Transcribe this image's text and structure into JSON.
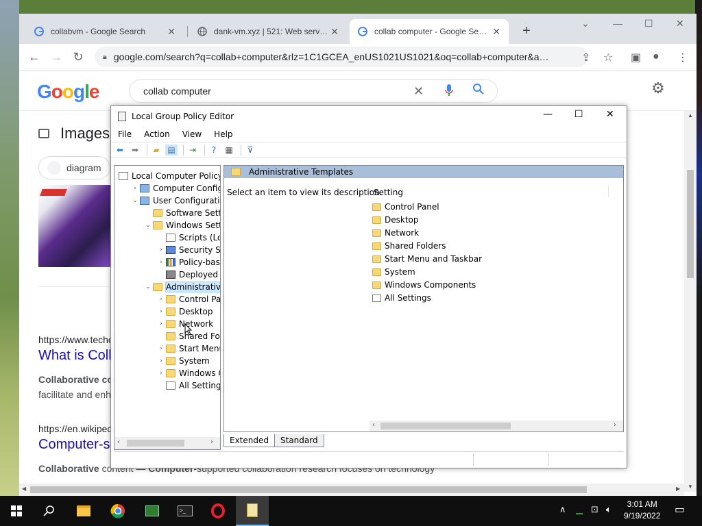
{
  "browser": {
    "tabs": [
      {
        "title": "collabvm - Google Search"
      },
      {
        "title": "dank-vm.xyz | 521: Web server is down"
      },
      {
        "title": "collab computer - Google Search"
      }
    ],
    "url": "google.com/search?q=collab+computer&rlz=1C1GCEA_enUS1021US1021&oq=collab+computer&aqs=ch..."
  },
  "google": {
    "logo": "Google",
    "query": "collab computer",
    "images_heading": "Images",
    "chip": "diagram",
    "results": [
      {
        "url": "https://www.techo",
        "title": "What is Coll",
        "snippet_bold": "Collaborative co",
        "snippet2": "facilitate and enh"
      },
      {
        "url": "https://en.wikipec",
        "title": "Computer-s",
        "snippet_bold1": "Collaborative",
        "snippet_mid": " content — ",
        "snippet_bold2": "Computer",
        "snippet_rest": "-supported collaboration research focuses on technology"
      }
    ]
  },
  "gpe": {
    "title": "Local Group Policy Editor",
    "menu": [
      "File",
      "Action",
      "View",
      "Help"
    ],
    "tree": [
      {
        "label": "Local Computer Policy",
        "indent": 0,
        "icon": "doc",
        "exp": ""
      },
      {
        "label": "Computer Configura",
        "indent": 1,
        "icon": "pc",
        "exp": "›"
      },
      {
        "label": "User Configuration",
        "indent": 1,
        "icon": "pc",
        "exp": "⌄"
      },
      {
        "label": "Software Settings",
        "indent": 2,
        "icon": "folder",
        "exp": ""
      },
      {
        "label": "Windows Setting",
        "indent": 2,
        "icon": "folder",
        "exp": "⌄"
      },
      {
        "label": "Scripts (Logor",
        "indent": 3,
        "icon": "doc",
        "exp": ""
      },
      {
        "label": "Security Settir",
        "indent": 3,
        "icon": "shield",
        "exp": "›"
      },
      {
        "label": "Policy-based",
        "indent": 3,
        "icon": "bars",
        "exp": "›"
      },
      {
        "label": "Deployed Prir",
        "indent": 3,
        "icon": "printer",
        "exp": ""
      },
      {
        "label": "Administrative Te",
        "indent": 2,
        "icon": "folder",
        "exp": "⌄",
        "selected": true
      },
      {
        "label": "Control Panel",
        "indent": 3,
        "icon": "folder",
        "exp": "›"
      },
      {
        "label": "Desktop",
        "indent": 3,
        "icon": "folder",
        "exp": "›"
      },
      {
        "label": "Network",
        "indent": 3,
        "icon": "folder",
        "exp": "›"
      },
      {
        "label": "Shared Folder",
        "indent": 3,
        "icon": "folder",
        "exp": ""
      },
      {
        "label": "Start Menu ar",
        "indent": 3,
        "icon": "folder",
        "exp": "›"
      },
      {
        "label": "System",
        "indent": 3,
        "icon": "folder",
        "exp": "›"
      },
      {
        "label": "Windows Cor",
        "indent": 3,
        "icon": "folder",
        "exp": "›"
      },
      {
        "label": "All Settings",
        "indent": 3,
        "icon": "doc",
        "exp": ""
      }
    ],
    "pane_header": "Administrative Templates",
    "description": "Select an item to view its description.",
    "column": "Setting",
    "items": [
      {
        "label": "Control Panel",
        "icon": "folder"
      },
      {
        "label": "Desktop",
        "icon": "folder"
      },
      {
        "label": "Network",
        "icon": "folder"
      },
      {
        "label": "Shared Folders",
        "icon": "folder"
      },
      {
        "label": "Start Menu and Taskbar",
        "icon": "folder"
      },
      {
        "label": "System",
        "icon": "folder"
      },
      {
        "label": "Windows Components",
        "icon": "folder"
      },
      {
        "label": "All Settings",
        "icon": "doc"
      }
    ],
    "bottom_tabs": [
      "Extended",
      "Standard"
    ]
  },
  "taskbar": {
    "time": "3:01 AM",
    "date": "9/19/2022"
  },
  "colors": {
    "link": "#1a0dab",
    "selection": "#cce8ff",
    "pane_header": "#a9bfd9"
  }
}
